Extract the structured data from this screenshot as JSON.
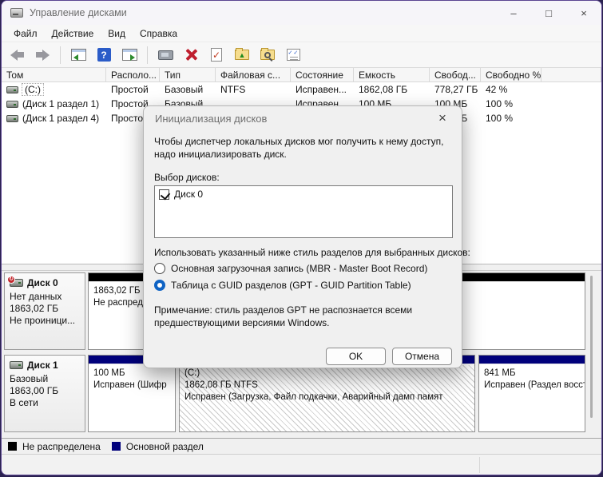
{
  "window": {
    "title": "Управление дисками",
    "controls": {
      "minimize": "–",
      "maximize": "□",
      "close": "×"
    }
  },
  "menu": {
    "items": [
      "Файл",
      "Действие",
      "Вид",
      "Справка"
    ]
  },
  "toolbar": {
    "icons": [
      "back",
      "forward",
      "show-console-tree",
      "help",
      "show-action-pane",
      "properties",
      "delete",
      "check-mark-document",
      "open-folder",
      "find-folder",
      "task-list"
    ]
  },
  "volume_table": {
    "columns": [
      "Том",
      "Располо...",
      "Тип",
      "Файловая с...",
      "Состояние",
      "Емкость",
      "Свобод...",
      "Свободно %"
    ],
    "rows": [
      {
        "volume": "(C:)",
        "layout": "Простой",
        "type": "Базовый",
        "fs": "NTFS",
        "status": "Исправен...",
        "capacity": "1862,08 ГБ",
        "free": "778,27 ГБ",
        "free_pct": "42 %"
      },
      {
        "volume": "(Диск 1 раздел 1)",
        "layout": "Простой",
        "type": "Базовый",
        "fs": "",
        "status": "Исправен...",
        "capacity": "100 МБ",
        "free": "100 МБ",
        "free_pct": "100 %"
      },
      {
        "volume": "(Диск 1 раздел 4)",
        "layout": "Простой",
        "type": "",
        "fs": "",
        "status": "",
        "capacity": "",
        "free": "841 МБ",
        "free_pct": "100 %"
      }
    ]
  },
  "dialog": {
    "title": "Инициализация дисков",
    "close_glyph": "×",
    "intro": "Чтобы диспетчер локальных дисков мог получить к нему доступ, надо инициализировать диск.",
    "select_label": "Выбор дисков:",
    "disk_items": [
      {
        "label": "Диск 0",
        "checked": true
      }
    ],
    "style_label": "Использовать указанный ниже стиль разделов для выбранных дисков:",
    "options": [
      {
        "label": "Основная загрузочная запись (MBR - Master Boot Record)",
        "selected": false
      },
      {
        "label": "Таблица с GUID разделов (GPT - GUID Partition Table)",
        "selected": true
      }
    ],
    "note": "Примечание: стиль разделов GPT не распознается всеми предшествующими версиями Windows.",
    "buttons": {
      "ok": "OK",
      "cancel": "Отмена"
    }
  },
  "graph": {
    "disks": [
      {
        "name": "Диск 0",
        "details": [
          "Нет данных",
          "1863,02 ГБ",
          "Не проиници..."
        ],
        "has_error_badge": true,
        "partitions": [
          {
            "name": "",
            "size": "1863,02 ГБ",
            "status": "Не распределена",
            "kind": "unallocated"
          }
        ]
      },
      {
        "name": "Диск 1",
        "details": [
          "Базовый",
          "1863,00 ГБ",
          "В сети"
        ],
        "has_error_badge": false,
        "partitions": [
          {
            "name": "",
            "size": "100 МБ",
            "status": "Исправен (Шифр",
            "kind": "primary"
          },
          {
            "name": "(C:)",
            "size": "1862,08 ГБ NTFS",
            "status": "Исправен (Загрузка, Файл подкачки, Аварийный дамп памят",
            "kind": "primary"
          },
          {
            "name": "",
            "size": "841 МБ",
            "status": "Исправен (Раздел восстанс",
            "kind": "primary"
          }
        ]
      }
    ]
  },
  "legend": {
    "items": [
      {
        "color": "#000000",
        "label": "Не распределена"
      },
      {
        "color": "#00007b",
        "label": "Основной раздел"
      }
    ]
  },
  "colors": {
    "unallocated": "#000000",
    "primary_partition": "#00007b",
    "selected_radio": "#0f63c4"
  }
}
